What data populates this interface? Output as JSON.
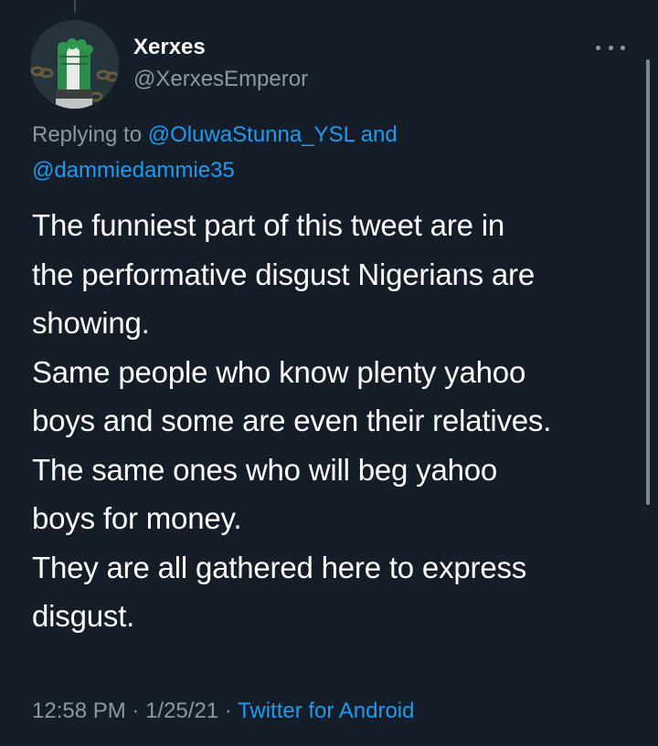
{
  "tweet": {
    "author_name": "Xerxes",
    "author_handle": "@XerxesEmperor",
    "reply_prefix": "Replying to ",
    "reply_mention_1": "@OluwaStunna_YSL",
    "reply_and": " and",
    "reply_mention_2": "@dammiedammie35",
    "body_lines": [
      "The funniest part of this tweet are in",
      "the performative disgust Nigerians are",
      "showing.",
      "Same people who know plenty yahoo",
      "boys and some are even their relatives.",
      "The same ones who will beg yahoo",
      "boys for money.",
      "They are all gathered here to express",
      "disgust."
    ],
    "time": "12:58 PM",
    "separator": " · ",
    "date": "1/25/21",
    "source": "Twitter for Android"
  },
  "icons": {
    "more": "more-options-icon",
    "avatar": "avatar-nigeria-fist"
  },
  "colors": {
    "background": "#151d28",
    "text": "#ffffff",
    "secondary": "#8b98a5",
    "link": "#1d9bf0",
    "flag_green": "#2c8a4a"
  }
}
